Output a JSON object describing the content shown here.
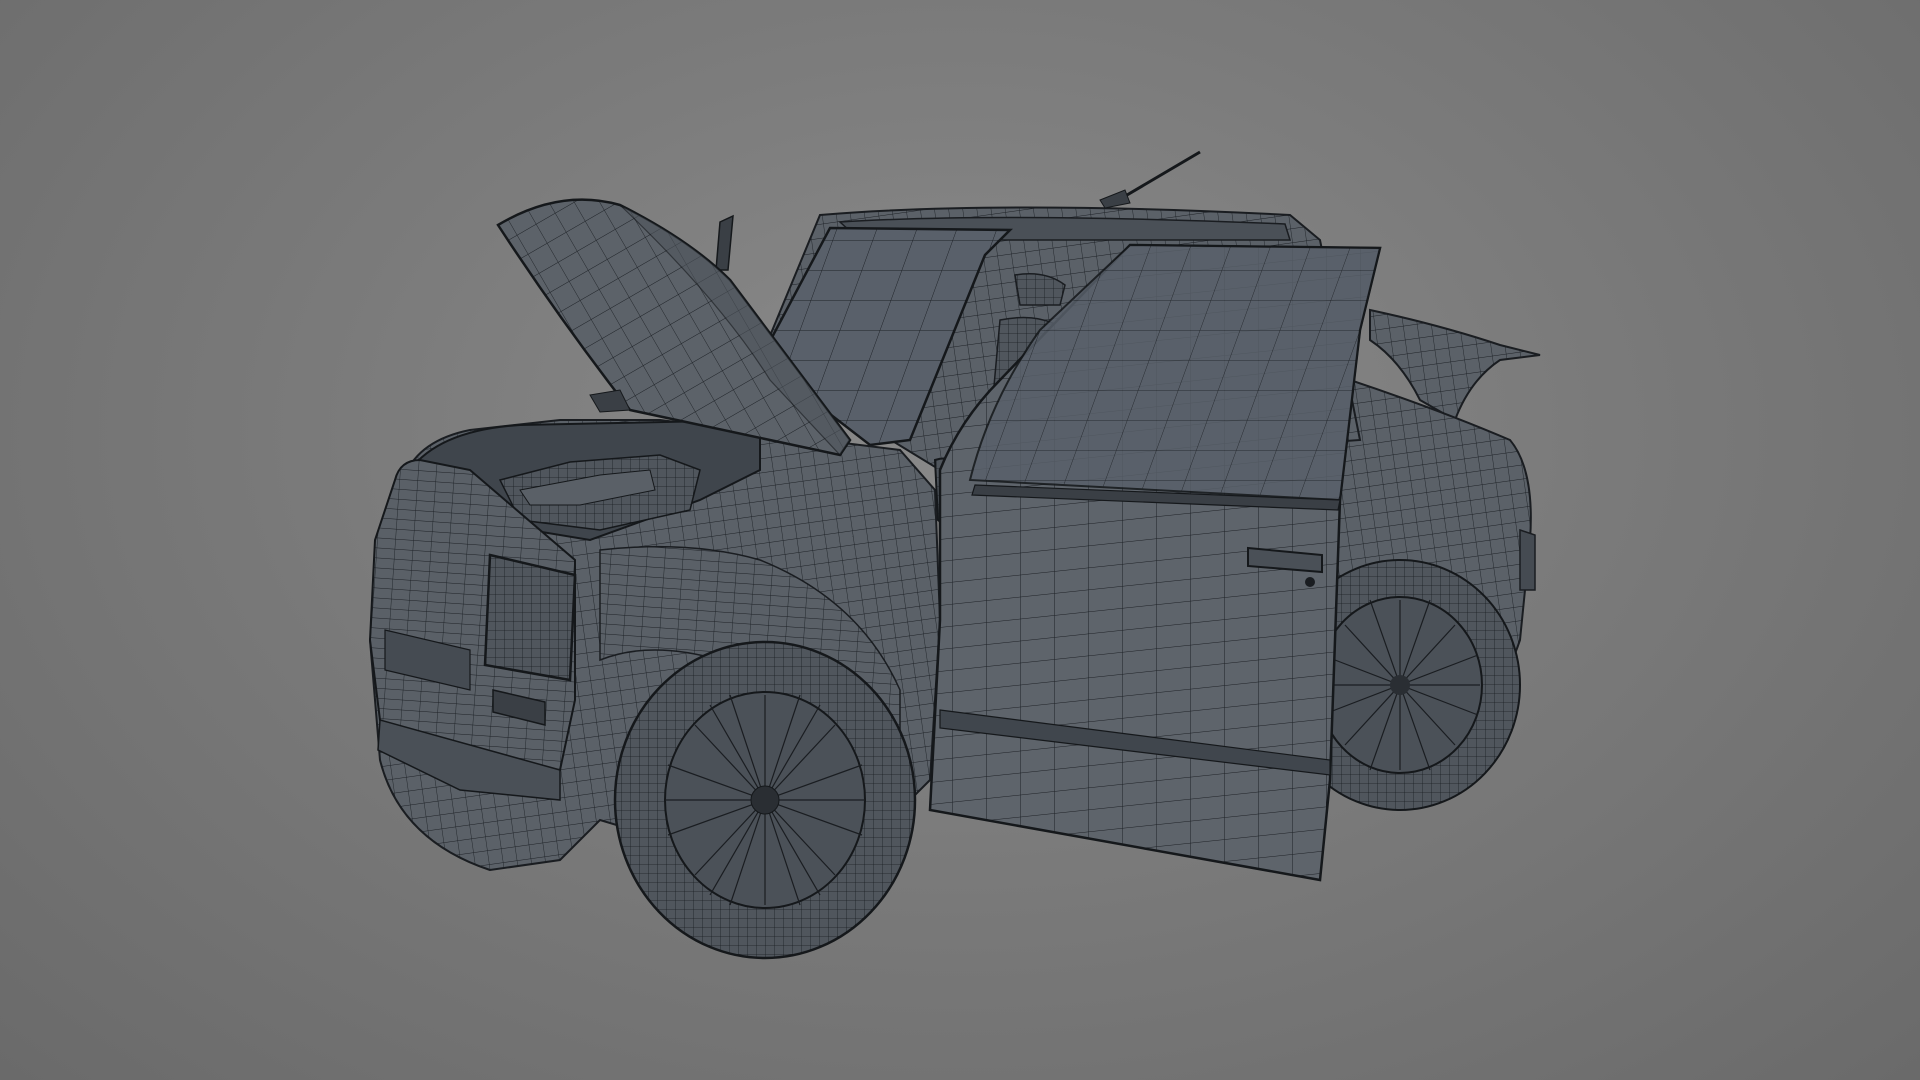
{
  "scene": {
    "subject": "car-wireframe-model",
    "background_color": "#7a7a7a",
    "mesh_fill": "#5b6168",
    "mesh_fill_dark": "#454b52",
    "wire_color": "#1d2126",
    "edge_highlight": "#8d949b"
  },
  "model_parts": [
    "body",
    "hood-open",
    "door-open",
    "windshield",
    "front-wheel",
    "rear-wheel",
    "engine-bay",
    "headlight",
    "side-mirror",
    "roof-antenna",
    "rear-spoiler",
    "door-handle",
    "grille"
  ]
}
